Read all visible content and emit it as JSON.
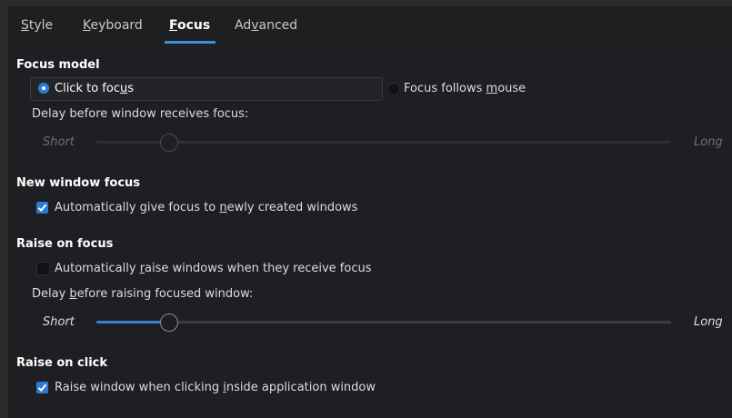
{
  "tabs": [
    {
      "label_pre": "",
      "label_ul": "S",
      "label_post": "tyle",
      "active": false
    },
    {
      "label_pre": "",
      "label_ul": "K",
      "label_post": "eyboard",
      "active": false
    },
    {
      "label_pre": "",
      "label_ul": "F",
      "label_post": "ocus",
      "active": true
    },
    {
      "label_pre": "Ad",
      "label_ul": "v",
      "label_post": "anced",
      "active": false
    }
  ],
  "focus_model": {
    "heading": "Focus model",
    "click_to_focus": {
      "pre": "Click to foc",
      "ul": "u",
      "post": "s",
      "selected": true
    },
    "follows_mouse": {
      "pre": "Focus follows ",
      "ul": "m",
      "post": "ouse",
      "selected": false
    },
    "delay_label": "Delay before window receives focus:",
    "slider": {
      "min_label": "Short",
      "max_label": "Long",
      "level": 0.12,
      "enabled": false
    }
  },
  "new_window_focus": {
    "heading": "New window focus",
    "auto_focus": {
      "pre": "Automatically give focus to ",
      "ul": "n",
      "post": "ewly created windows",
      "checked": true
    }
  },
  "raise_on_focus": {
    "heading": "Raise on focus",
    "auto_raise": {
      "pre": "Automatically ",
      "ul": "r",
      "post": "aise windows when they receive focus",
      "checked": false
    },
    "delay_label": {
      "pre": "Delay ",
      "ul": "b",
      "post": "efore raising focused window:"
    },
    "slider": {
      "min_label": "Short",
      "max_label": "Long",
      "level": 0.12,
      "enabled": true
    }
  },
  "raise_on_click": {
    "heading": "Raise on click",
    "raise_click": {
      "pre": "Raise window when clicking ",
      "ul": "i",
      "post": "nside application window",
      "checked": true
    }
  }
}
